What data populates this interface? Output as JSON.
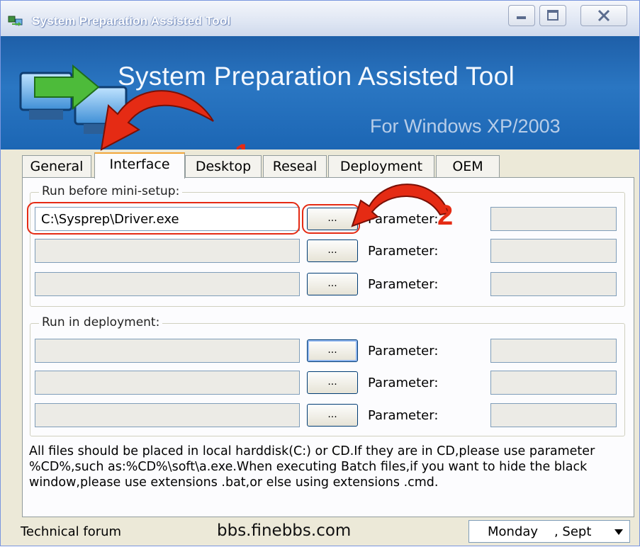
{
  "window": {
    "title": "System Preparation Assisted Tool"
  },
  "banner": {
    "title": "System Preparation Assisted Tool",
    "subtitle": "For Windows XP/2003"
  },
  "annotations": {
    "step1": "1",
    "step2": "2",
    "color": "#e52b14"
  },
  "tabs": [
    {
      "label": "General",
      "active": false
    },
    {
      "label": "Interface",
      "active": true
    },
    {
      "label": "Desktop",
      "active": false
    },
    {
      "label": "Reseal",
      "active": false
    },
    {
      "label": "Deployment",
      "active": false
    },
    {
      "label": "OEM",
      "active": false
    }
  ],
  "run_before": {
    "label": "Run before mini-setup:",
    "rows": [
      {
        "path": "C:\\Sysprep\\Driver.exe",
        "browse": "...",
        "param_label": "Parameter:",
        "param": ""
      },
      {
        "path": "",
        "browse": "...",
        "param_label": "Parameter:",
        "param": ""
      },
      {
        "path": "",
        "browse": "...",
        "param_label": "Parameter:",
        "param": ""
      }
    ]
  },
  "run_deploy": {
    "label": "Run in deployment:",
    "rows": [
      {
        "path": "",
        "browse": "...",
        "param_label": "Parameter:",
        "param": ""
      },
      {
        "path": "",
        "browse": "...",
        "param_label": "Parameter:",
        "param": ""
      },
      {
        "path": "",
        "browse": "...",
        "param_label": "Parameter:",
        "param": ""
      }
    ]
  },
  "note": "All files should be placed in local harddisk(C:) or CD.If they are in CD,please use parameter %CD%,such as:%CD%\\soft\\a.exe.When executing Batch files,if you want to hide the black window,please use extensions .bat,or else using  extensions .cmd.",
  "status": {
    "forum_label": "Technical forum",
    "url": "bbs.finebbs.com",
    "date_value": "Monday    , Sept"
  },
  "colors": {
    "title_bar": "#dfe6f3",
    "banner": "#2a76c2",
    "tab_highlight": "#f3a73a",
    "panel": "#fcfcfe",
    "window_face": "#ece9d8"
  }
}
